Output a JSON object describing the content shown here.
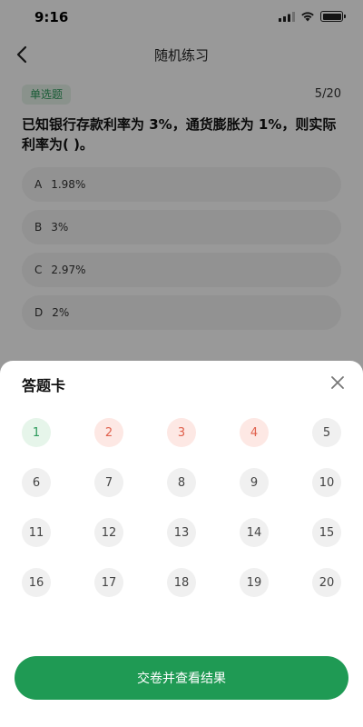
{
  "status_bar": {
    "time": "9:16"
  },
  "nav": {
    "title": "随机练习"
  },
  "question": {
    "type_tag": "单选题",
    "progress": "5/20",
    "text": "已知银行存款利率为 3%，通货膨胀为 1%，则实际利率为( )。",
    "options": [
      {
        "key": "A",
        "text": "1.98%"
      },
      {
        "key": "B",
        "text": "3%"
      },
      {
        "key": "C",
        "text": "2.97%"
      },
      {
        "key": "D",
        "text": "2%"
      }
    ]
  },
  "answer_sheet": {
    "title": "答题卡",
    "cells": [
      {
        "number": "1",
        "state": "correct"
      },
      {
        "number": "2",
        "state": "wrong"
      },
      {
        "number": "3",
        "state": "wrong"
      },
      {
        "number": "4",
        "state": "wrong"
      },
      {
        "number": "5",
        "state": "unanswered"
      },
      {
        "number": "6",
        "state": "unanswered"
      },
      {
        "number": "7",
        "state": "unanswered"
      },
      {
        "number": "8",
        "state": "unanswered"
      },
      {
        "number": "9",
        "state": "unanswered"
      },
      {
        "number": "10",
        "state": "unanswered"
      },
      {
        "number": "11",
        "state": "unanswered"
      },
      {
        "number": "12",
        "state": "unanswered"
      },
      {
        "number": "13",
        "state": "unanswered"
      },
      {
        "number": "14",
        "state": "unanswered"
      },
      {
        "number": "15",
        "state": "unanswered"
      },
      {
        "number": "16",
        "state": "unanswered"
      },
      {
        "number": "17",
        "state": "unanswered"
      },
      {
        "number": "18",
        "state": "unanswered"
      },
      {
        "number": "19",
        "state": "unanswered"
      },
      {
        "number": "20",
        "state": "unanswered"
      }
    ],
    "submit_label": "交卷并查看结果"
  },
  "colors": {
    "accent_green": "#1f9a54",
    "correct_bg": "#e6f5ea",
    "wrong_bg": "#fde8e4",
    "overlay": "rgba(0,0,0,0.4)"
  },
  "icons": [
    "signal-icon",
    "wifi-icon",
    "battery-icon",
    "back-arrow-icon",
    "close-icon"
  ]
}
